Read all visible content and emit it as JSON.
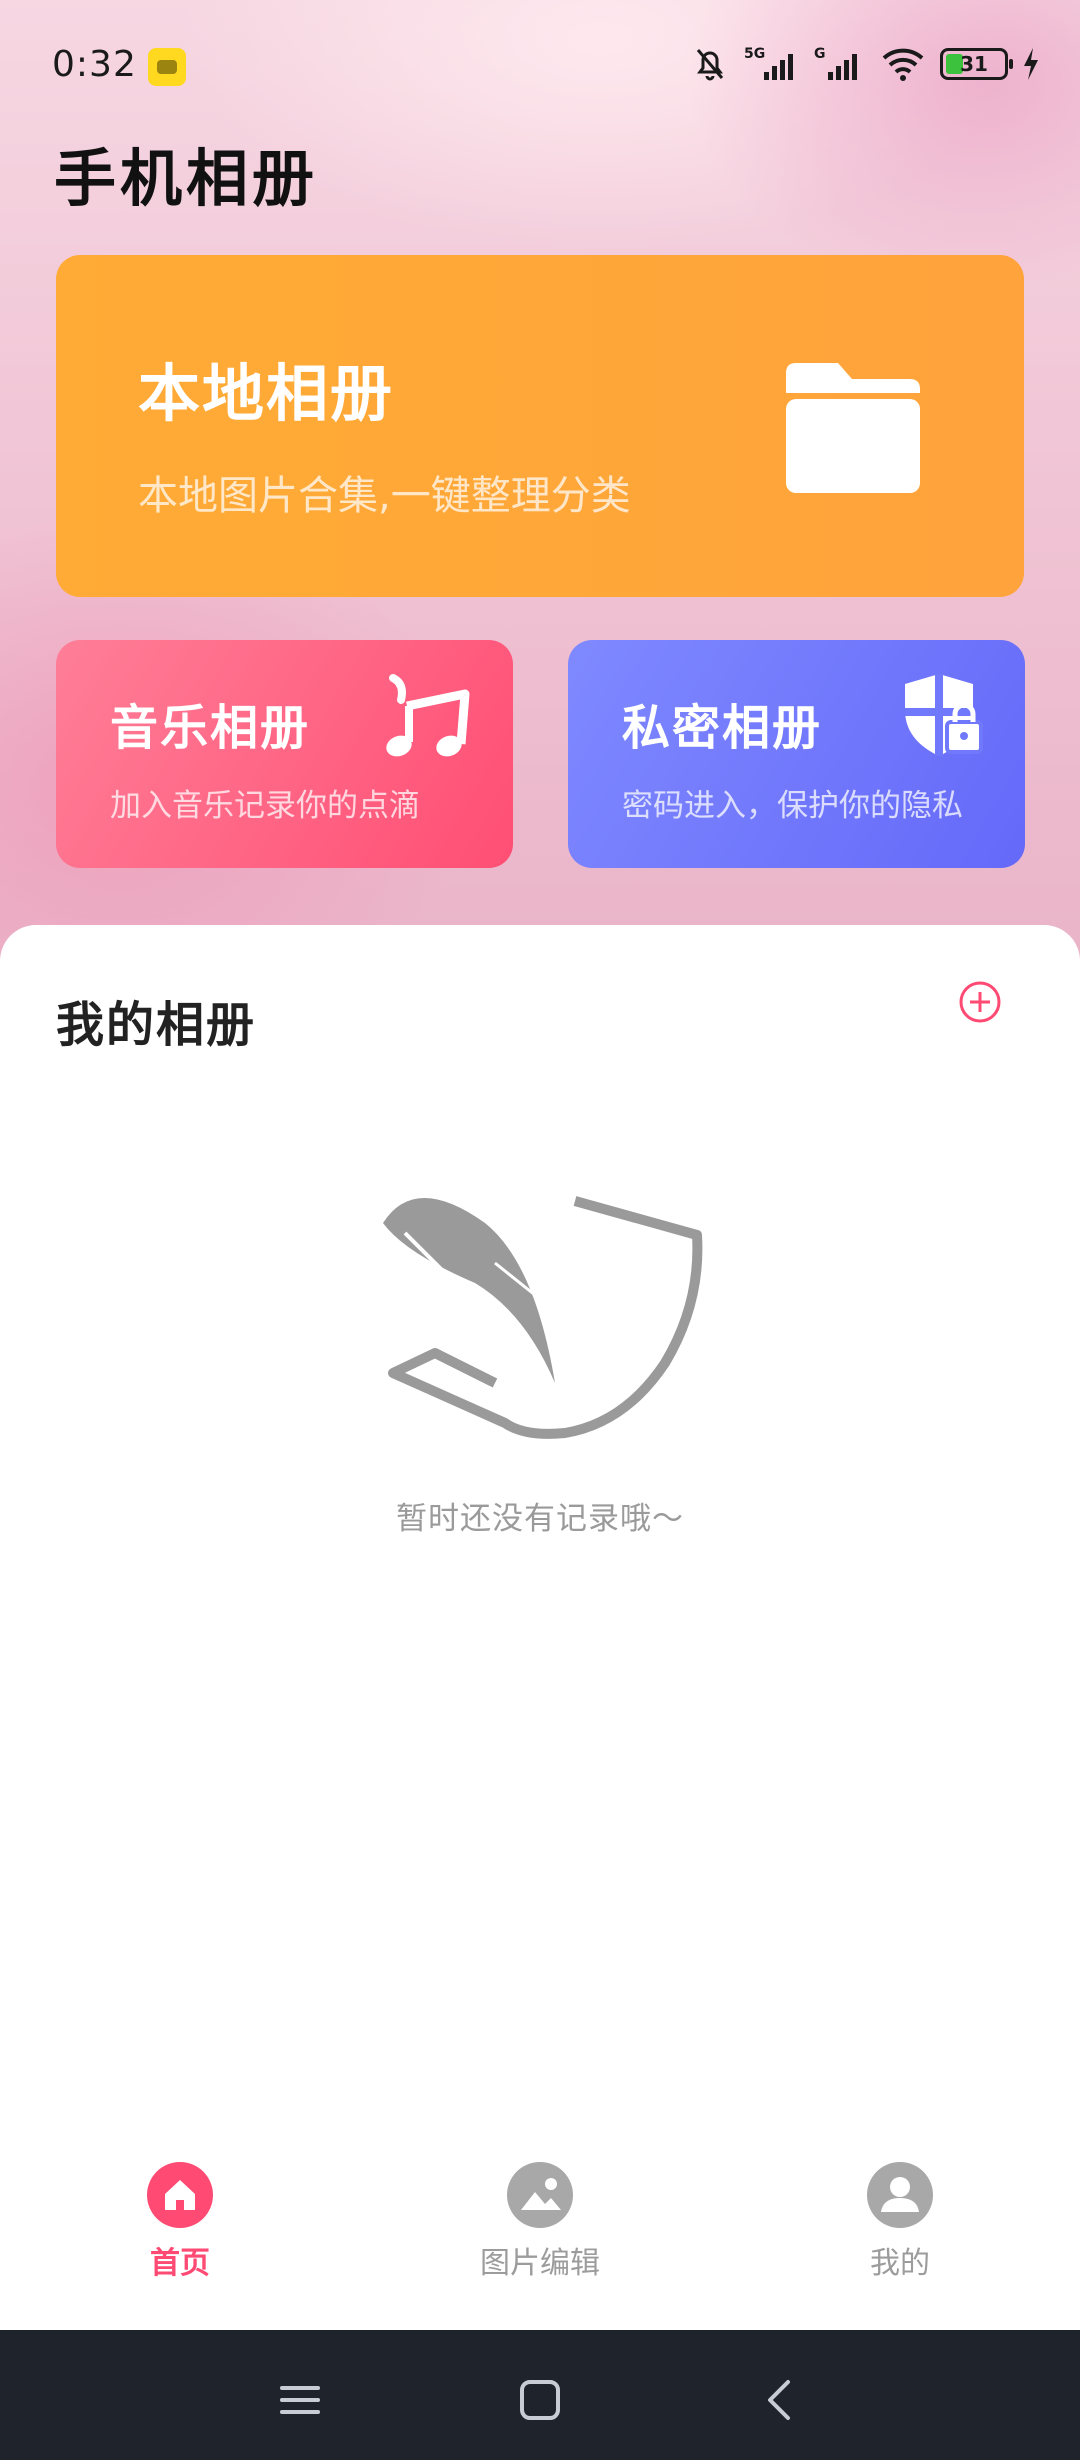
{
  "status_bar": {
    "time": "0:32",
    "network1": "5G",
    "network2": "G",
    "battery_level": "31",
    "battery_fraction": 0.31
  },
  "app": {
    "title": "手机相册"
  },
  "cards": {
    "local": {
      "title": "本地相册",
      "subtitle": "本地图片合集,一键整理分类",
      "icon": "folder-icon"
    },
    "music": {
      "title": "音乐相册",
      "subtitle": "加入音乐记录你的点滴",
      "icon": "music-note-icon"
    },
    "private": {
      "title": "私密相册",
      "subtitle": "密码进入，保护你的隐私",
      "icon": "shield-lock-icon"
    }
  },
  "my_albums": {
    "title": "我的相册",
    "add_icon": "plus-circle-icon",
    "empty_text": "暂时还没有记录哦～",
    "empty_icon": "quill-paper-icon"
  },
  "tabs": [
    {
      "label": "首页",
      "icon": "home-icon",
      "active": true
    },
    {
      "label": "图片编辑",
      "icon": "image-edit-icon",
      "active": false
    },
    {
      "label": "我的",
      "icon": "user-icon",
      "active": false
    }
  ],
  "colors": {
    "accent": "#ff4a73",
    "local_card": "#ffa83a",
    "music_card": "#ff5c7e",
    "private_card": "#7079fc",
    "navbar": "#1f232c"
  },
  "nav_buttons": [
    "menu-icon",
    "home-square-icon",
    "back-icon"
  ]
}
